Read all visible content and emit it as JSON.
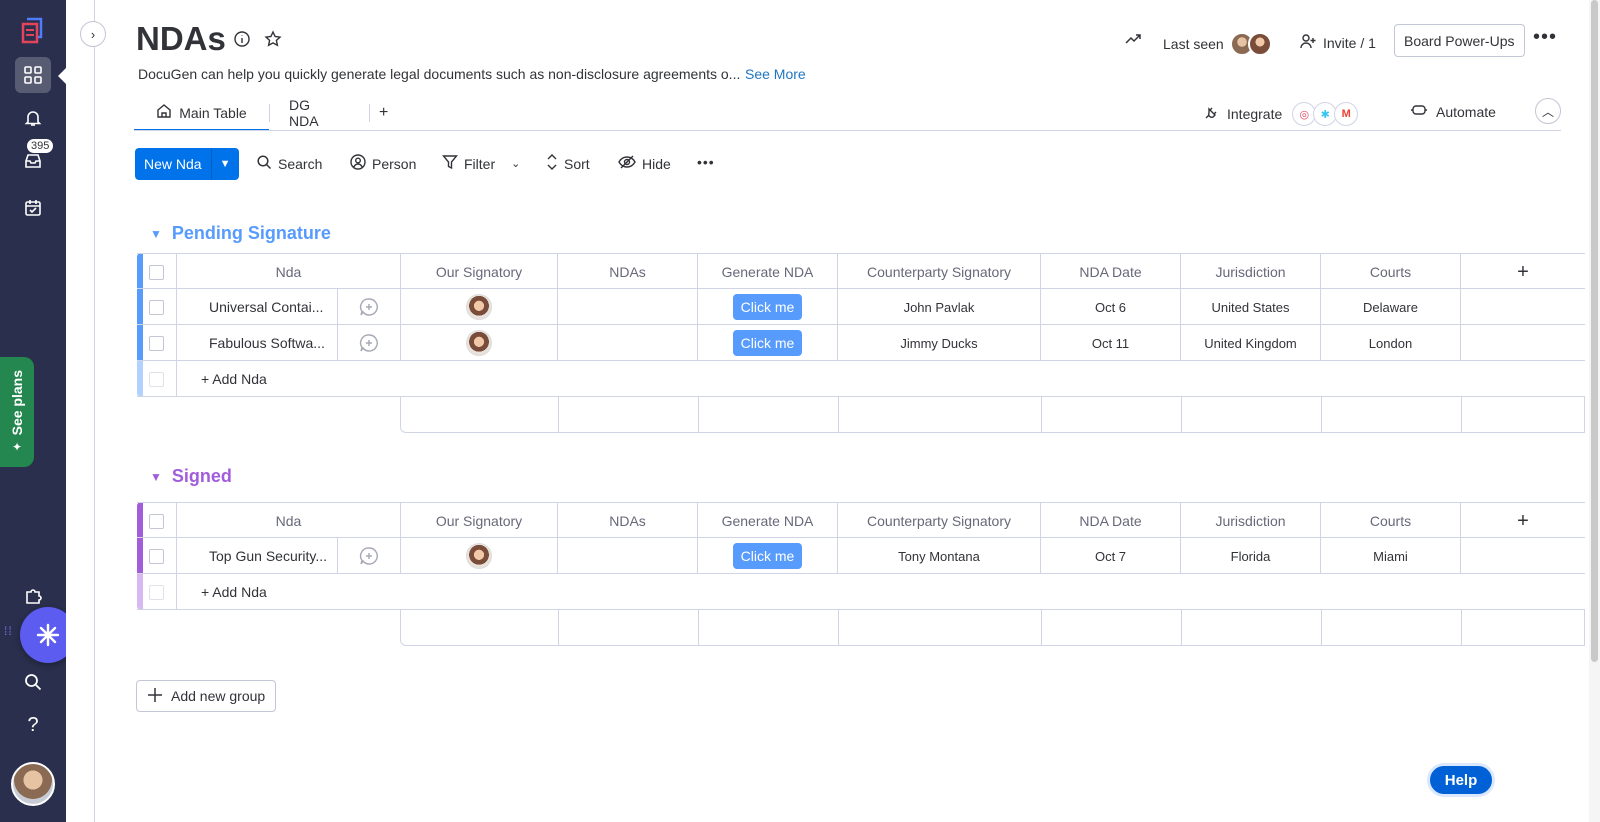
{
  "sidebar": {
    "inbox_badge": "395",
    "see_plans": "See plans"
  },
  "board": {
    "title": "NDAs",
    "description": "DocuGen can help you quickly generate legal documents such as non-disclosure agreements o...",
    "see_more": "See More"
  },
  "header": {
    "last_seen": "Last seen",
    "invite": "Invite / 1",
    "power_ups": "Board Power-Ups"
  },
  "tabs": [
    {
      "label": "Main Table",
      "active": true
    },
    {
      "label": "DG NDA",
      "active": false
    }
  ],
  "integrations": {
    "integrate_label": "Integrate",
    "automate_label": "Automate"
  },
  "toolbar": {
    "new_item": "New Nda",
    "search": "Search",
    "person": "Person",
    "filter": "Filter",
    "sort": "Sort",
    "hide": "Hide"
  },
  "columns": [
    "Nda",
    "Our Signatory",
    "NDAs",
    "Generate NDA",
    "Counterparty Signatory",
    "NDA Date",
    "Jurisdiction",
    "Courts"
  ],
  "groups": [
    {
      "title": "Pending Signature",
      "color": "#579bfc",
      "add_label": "+ Add Nda",
      "rows": [
        {
          "name": "Universal Contai...",
          "button": "Click me",
          "counterparty": "John Pavlak",
          "date": "Oct 6",
          "jurisdiction": "United States",
          "courts": "Delaware"
        },
        {
          "name": "Fabulous Softwa...",
          "button": "Click me",
          "counterparty": "Jimmy Ducks",
          "date": "Oct 11",
          "jurisdiction": "United Kingdom",
          "courts": "London"
        }
      ]
    },
    {
      "title": "Signed",
      "color": "#a25ddc",
      "add_label": "+ Add Nda",
      "rows": [
        {
          "name": "Top Gun Security...",
          "button": "Click me",
          "counterparty": "Tony Montana",
          "date": "Oct 7",
          "jurisdiction": "Florida",
          "courts": "Miami"
        }
      ]
    }
  ],
  "add_group": "Add new group",
  "help": "Help"
}
